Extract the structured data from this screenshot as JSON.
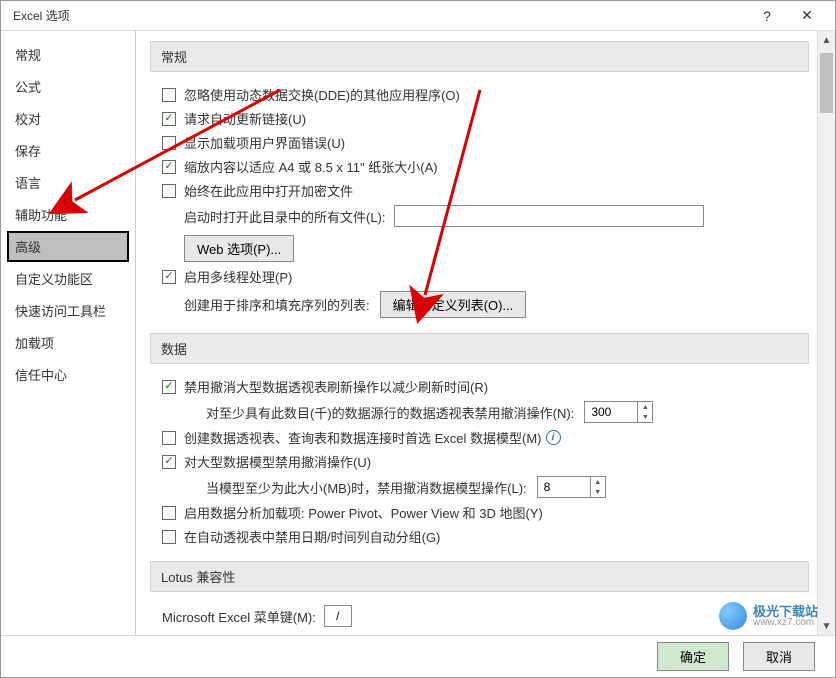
{
  "window": {
    "title": "Excel 选项",
    "help": "?",
    "close": "✕"
  },
  "sidebar": {
    "items": [
      {
        "label": "常规"
      },
      {
        "label": "公式"
      },
      {
        "label": "校对"
      },
      {
        "label": "保存"
      },
      {
        "label": "语言"
      },
      {
        "label": "辅助功能"
      },
      {
        "label": "高级",
        "selected": true
      },
      {
        "label": "自定义功能区"
      },
      {
        "label": "快速访问工具栏"
      },
      {
        "label": "加载项"
      },
      {
        "label": "信任中心"
      }
    ]
  },
  "sections": {
    "general": {
      "header": "常规",
      "opt_dde": "忽略使用动态数据交换(DDE)的其他应用程序(O)",
      "opt_update": "请求自动更新链接(U)",
      "opt_addin_err": "显示加载项用户界面错误(U)",
      "opt_scale": "缩放内容以适应 A4 或 8.5 x 11\" 纸张大小(A)",
      "opt_encrypt": "始终在此应用中打开加密文件",
      "startup_label": "启动时打开此目录中的所有文件(L):",
      "startup_value": "",
      "web_btn": "Web 选项(P)...",
      "opt_multithread": "启用多线程处理(P)",
      "customlist_label": "创建用于排序和填充序列的列表:",
      "customlist_btn": "编辑自定义列表(O)..."
    },
    "data": {
      "header": "数据",
      "opt_pivot_undo": "禁用撤消大型数据透视表刷新操作以减少刷新时间(R)",
      "pivot_rows_label": "对至少具有此数目(千)的数据源行的数据透视表禁用撤消操作(N):",
      "pivot_rows_value": "300",
      "opt_prefer_edm": "创建数据透视表、查询表和数据连接时首选 Excel 数据模型(M)",
      "opt_large_model": "对大型数据模型禁用撤消操作(U)",
      "model_mb_label": "当模型至少为此大小(MB)时，禁用撤消数据模型操作(L):",
      "model_mb_value": "8",
      "opt_analysis": "启用数据分析加载项: Power Pivot、Power View 和 3D 地图(Y)",
      "opt_disable_date_group": "在自动透视表中禁用日期/时间列自动分组(G)"
    },
    "lotus": {
      "header": "Lotus 兼容性",
      "menukey_label": "Microsoft Excel 菜单键(M):",
      "menukey_value": "/"
    }
  },
  "footer": {
    "ok": "确定",
    "cancel": "取消"
  },
  "watermark": {
    "name": "极光下载站",
    "url": "www.xz7.com"
  }
}
